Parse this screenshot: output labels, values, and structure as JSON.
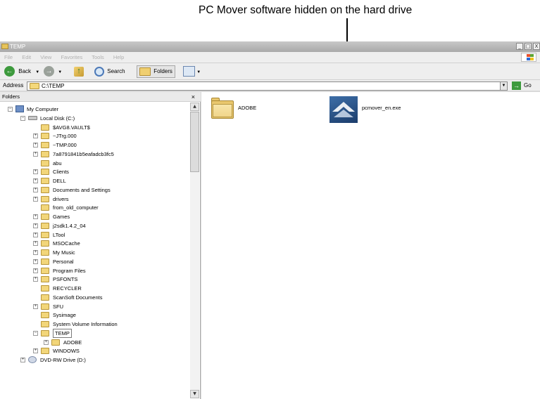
{
  "caption": "PC Mover software hidden on the hard drive",
  "window": {
    "title": "TEMP",
    "controls": [
      "_",
      "□",
      "X"
    ]
  },
  "menubar": [
    "File",
    "Edit",
    "View",
    "Favorites",
    "Tools",
    "Help"
  ],
  "toolbar": {
    "back": "Back",
    "search": "Search",
    "folders": "Folders"
  },
  "address": {
    "label": "Address",
    "value": "C:\\TEMP",
    "go": "Go"
  },
  "folders_panel": {
    "header": "Folders",
    "close": "×",
    "tree": [
      {
        "label": "My Computer",
        "expander": "−"
      },
      {
        "label": "Local Disk (C:)",
        "expander": "−"
      },
      {
        "label": "$AVG8.VAULT$",
        "expander": ""
      },
      {
        "label": "~JTrg.000",
        "expander": "+"
      },
      {
        "label": "~TMP.000",
        "expander": "+"
      },
      {
        "label": "7a8791841b5eafadcb3fc5",
        "expander": "+"
      },
      {
        "label": "abu",
        "expander": ""
      },
      {
        "label": "Clients",
        "expander": "+"
      },
      {
        "label": "DELL",
        "expander": "+"
      },
      {
        "label": "Documents and Settings",
        "expander": "+"
      },
      {
        "label": "drivers",
        "expander": "+"
      },
      {
        "label": "from_old_computer",
        "expander": ""
      },
      {
        "label": "Games",
        "expander": "+"
      },
      {
        "label": "j2sdk1.4.2_04",
        "expander": "+"
      },
      {
        "label": "LTool",
        "expander": "+"
      },
      {
        "label": "MSOCache",
        "expander": "+"
      },
      {
        "label": "My Music",
        "expander": "+"
      },
      {
        "label": "Personal",
        "expander": "+"
      },
      {
        "label": "Program Files",
        "expander": "+"
      },
      {
        "label": "PSFONTS",
        "expander": "+"
      },
      {
        "label": "RECYCLER",
        "expander": ""
      },
      {
        "label": "ScanSoft Documents",
        "expander": ""
      },
      {
        "label": "SFU",
        "expander": "+"
      },
      {
        "label": "Sysimage",
        "expander": ""
      },
      {
        "label": "System Volume Information",
        "expander": ""
      },
      {
        "label": "TEMP",
        "expander": "−"
      },
      {
        "label": "ADOBE",
        "expander": "+"
      },
      {
        "label": "WINDOWS",
        "expander": "+"
      },
      {
        "label": "DVD-RW Drive (D:)",
        "expander": "+"
      }
    ]
  },
  "content": {
    "items": [
      {
        "label": "ADOBE"
      },
      {
        "label": "pcmover_en.exe"
      }
    ]
  }
}
